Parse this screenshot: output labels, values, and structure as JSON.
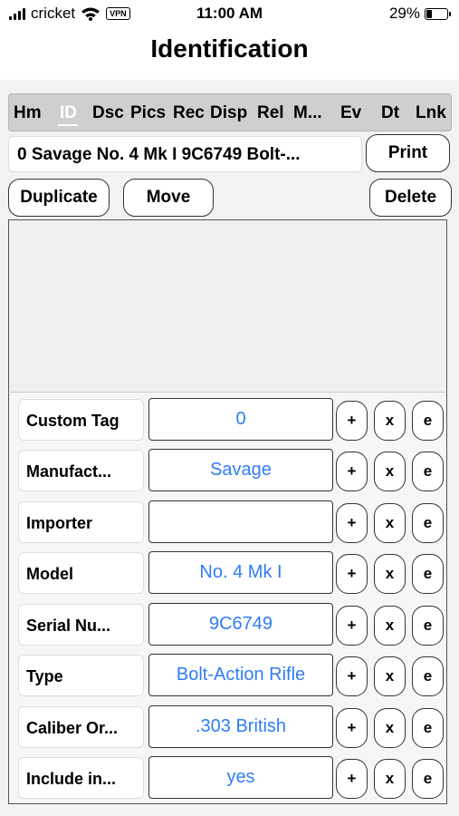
{
  "status_bar": {
    "carrier": "cricket",
    "vpn": "VPN",
    "time": "11:00 AM",
    "battery_percent": "29%",
    "battery_level": 0.29
  },
  "page_title": "Identification",
  "tabs": [
    {
      "label": "Hm",
      "selected": false
    },
    {
      "label": "ID",
      "selected": true
    },
    {
      "label": "Dsc",
      "selected": false
    },
    {
      "label": "Pics",
      "selected": false
    },
    {
      "label": "Rec",
      "selected": false
    },
    {
      "label": "Disp",
      "selected": false
    },
    {
      "label": "Rel",
      "selected": false
    },
    {
      "label": "M...",
      "selected": false
    },
    {
      "label": "Ev",
      "selected": false
    },
    {
      "label": "Dt",
      "selected": false
    },
    {
      "label": "Lnk",
      "selected": false
    }
  ],
  "record_name": "0 Savage  No. 4 Mk I 9C6749 Bolt-...",
  "buttons": {
    "print": "Print",
    "duplicate": "Duplicate",
    "move": "Move",
    "delete": "Delete"
  },
  "row_actions": {
    "add": "+",
    "clear": "x",
    "edit": "e"
  },
  "fields": [
    {
      "label": "Custom Tag",
      "value": "0"
    },
    {
      "label": "Manufact...",
      "value": "Savage"
    },
    {
      "label": "Importer",
      "value": ""
    },
    {
      "label": "Model",
      "value": "No. 4 Mk I"
    },
    {
      "label": "Serial Nu...",
      "value": "9C6749"
    },
    {
      "label": "Type",
      "value": "Bolt-Action Rifle"
    },
    {
      "label": "Caliber Or...",
      "value": ".303 British"
    },
    {
      "label": "Include in...",
      "value": "yes"
    }
  ],
  "colors": {
    "value_text": "#2f7cf6",
    "tab_bar": "#cfcfcf",
    "selected_tab_text": "#ffffff",
    "background": "#f2f2f2"
  }
}
